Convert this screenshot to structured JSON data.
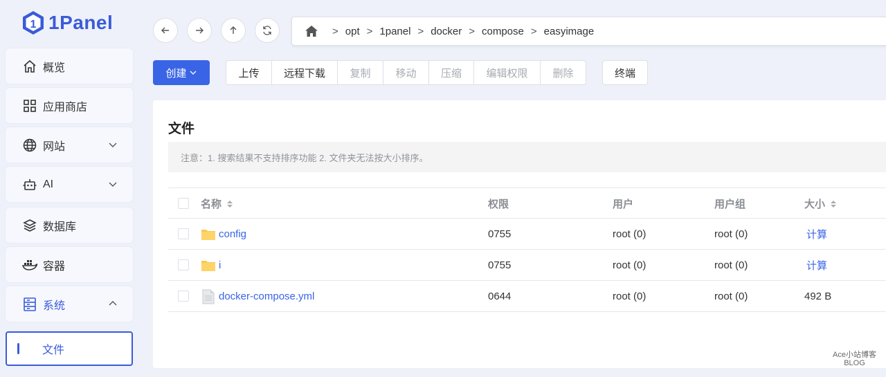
{
  "app": {
    "logo_text": "1Panel"
  },
  "sidebar": {
    "items": [
      {
        "label": "概览",
        "icon": "home-icon"
      },
      {
        "label": "应用商店",
        "icon": "grid-icon"
      },
      {
        "label": "网站",
        "icon": "globe-icon"
      },
      {
        "label": "AI",
        "icon": "robot-icon"
      },
      {
        "label": "数据库",
        "icon": "database-icon"
      },
      {
        "label": "容器",
        "icon": "docker-icon"
      },
      {
        "label": "系统",
        "icon": "server-icon"
      }
    ],
    "sub_active": "文件"
  },
  "breadcrumb": [
    "opt",
    "1panel",
    "docker",
    "compose",
    "easyimage"
  ],
  "breadcrumb_sep": ">",
  "toolbar": {
    "create": "创建",
    "group": [
      "上传",
      "远程下载",
      "复制",
      "移动",
      "压缩",
      "编辑权限",
      "删除"
    ],
    "terminal": "终端"
  },
  "card": {
    "title": "文件",
    "notice": "注意：1. 搜索结果不支持排序功能 2. 文件夹无法按大小排序。"
  },
  "table": {
    "headers": {
      "name": "名称",
      "perm": "权限",
      "user": "用户",
      "group": "用户组",
      "size": "大小"
    },
    "rows": [
      {
        "name": "config",
        "type": "folder",
        "perm": "0755",
        "user": "root (0)",
        "group": "root (0)",
        "size": "计算"
      },
      {
        "name": "i",
        "type": "folder",
        "perm": "0755",
        "user": "root (0)",
        "group": "root (0)",
        "size": "计算"
      },
      {
        "name": "docker-compose.yml",
        "type": "file",
        "perm": "0644",
        "user": "root (0)",
        "group": "root (0)",
        "size": "492 B"
      }
    ]
  },
  "watermark": [
    "Ace小站博客",
    "BLOG"
  ],
  "colors": {
    "accent": "#3a64e6",
    "folder": "#f9c94e"
  }
}
